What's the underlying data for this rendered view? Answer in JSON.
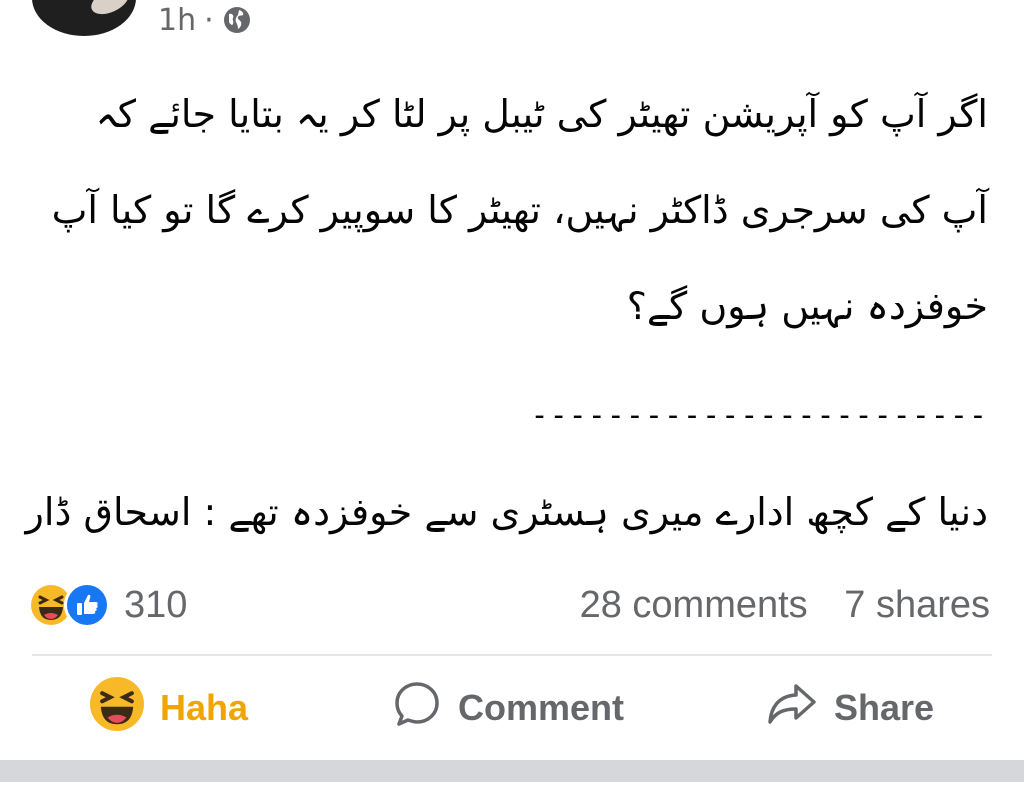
{
  "header": {
    "time": "1h",
    "separator": "·",
    "privacy_icon": "globe-icon"
  },
  "post": {
    "paragraph": "اگر آپ کو آپریشن تھیٹر کی ٹیبل پر لٹا کر یہ بتایا جائے کہ آپ کی سرجری ڈاکٹر نہیں، تھیٹر کا سوپیر کرے گا تو کیا آپ خوفزدہ نہیں ہوں گے؟",
    "separator_line": "------------------------",
    "quote": "دنیا کے کچھ ادارے میری ہسٹری سے خوفزدہ تھے : اسحاق ڈار"
  },
  "stats": {
    "reaction_icons": [
      "haha-icon",
      "like-icon"
    ],
    "reaction_count": "310",
    "comments": "28 comments",
    "shares": "7 shares"
  },
  "actions": {
    "haha_label": "Haha",
    "comment_label": "Comment",
    "share_label": "Share"
  },
  "colors": {
    "haha_accent": "#f0a500",
    "like_blue": "#1877f2",
    "muted_text": "#65676b",
    "divider": "#e4e6eb"
  }
}
